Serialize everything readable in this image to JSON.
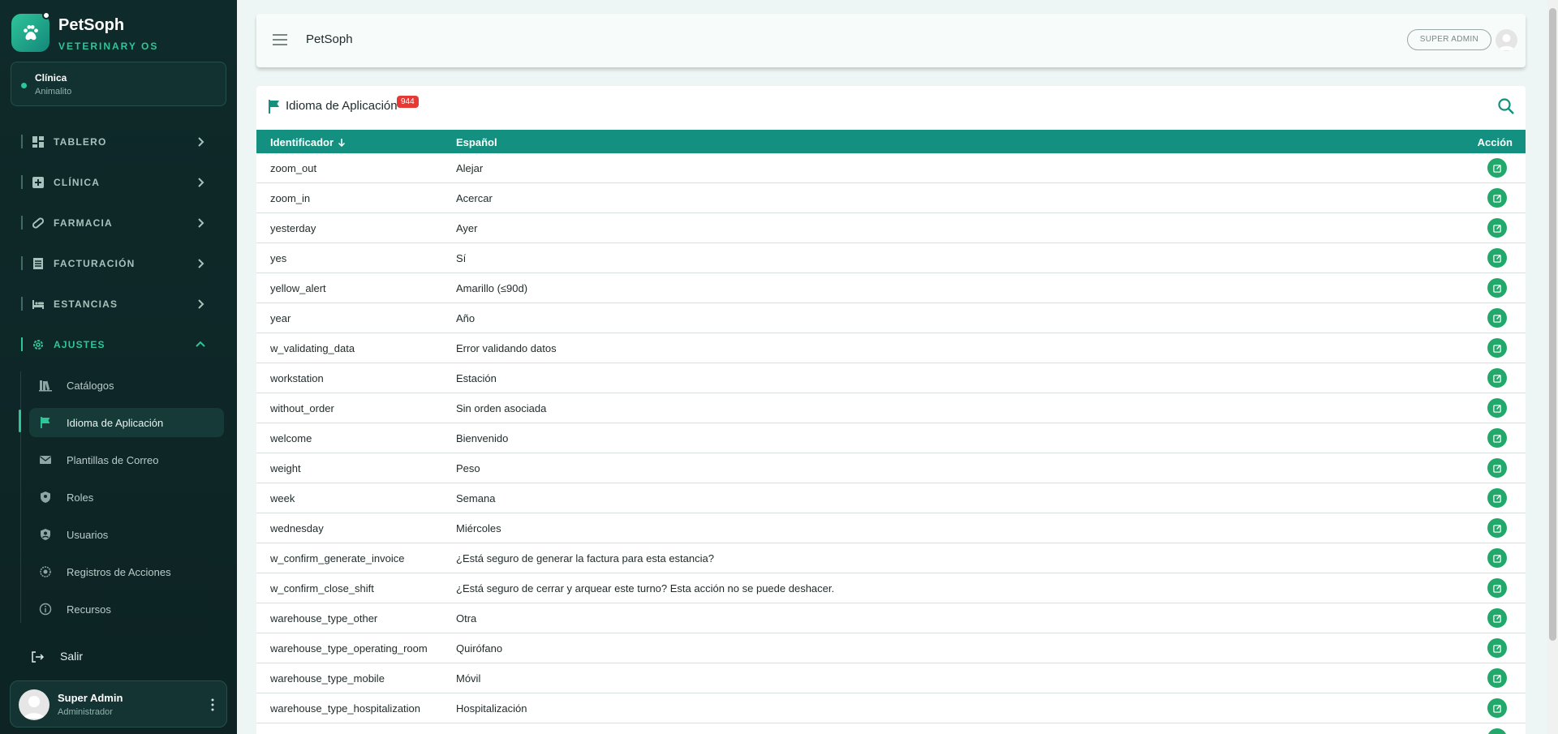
{
  "brand": {
    "name": "PetSoph",
    "subtitle": "VETERINARY OS"
  },
  "clinic": {
    "title": "Clínica",
    "name": "Animalito"
  },
  "nav": [
    {
      "label": "TABLERO",
      "icon": "dashboard-icon"
    },
    {
      "label": "CLÍNICA",
      "icon": "medical-plus-icon"
    },
    {
      "label": "FARMACIA",
      "icon": "pill-icon"
    },
    {
      "label": "FACTURACIÓN",
      "icon": "receipt-icon"
    },
    {
      "label": "ESTANCIAS",
      "icon": "bed-icon"
    },
    {
      "label": "AJUSTES",
      "icon": "gear-icon"
    }
  ],
  "subnav": [
    {
      "label": "Catálogos",
      "icon": "books-icon"
    },
    {
      "label": "Idioma de Aplicación",
      "icon": "flag-icon"
    },
    {
      "label": "Plantillas de Correo",
      "icon": "mail-template-icon"
    },
    {
      "label": "Roles",
      "icon": "shield-icon"
    },
    {
      "label": "Usuarios",
      "icon": "user-shield-icon"
    },
    {
      "label": "Registros de Acciones",
      "icon": "log-icon"
    },
    {
      "label": "Recursos",
      "icon": "info-icon"
    }
  ],
  "logout": {
    "label": "Salir"
  },
  "user": {
    "name": "Super Admin",
    "role": "Administrador"
  },
  "topbar": {
    "title": "PetSoph",
    "role_badge": "SUPER ADMIN"
  },
  "card": {
    "title": "Idioma de Aplicación",
    "count": "944"
  },
  "table": {
    "headers": {
      "id": "Identificador",
      "es": "Español",
      "action": "Acción"
    },
    "rows": [
      {
        "id": "zoom_out",
        "es": "Alejar"
      },
      {
        "id": "zoom_in",
        "es": "Acercar"
      },
      {
        "id": "yesterday",
        "es": "Ayer"
      },
      {
        "id": "yes",
        "es": "Sí"
      },
      {
        "id": "yellow_alert",
        "es": "Amarillo (≤90d)"
      },
      {
        "id": "year",
        "es": "Año"
      },
      {
        "id": "w_validating_data",
        "es": "Error validando datos"
      },
      {
        "id": "workstation",
        "es": "Estación"
      },
      {
        "id": "without_order",
        "es": "Sin orden asociada"
      },
      {
        "id": "welcome",
        "es": "Bienvenido"
      },
      {
        "id": "weight",
        "es": "Peso"
      },
      {
        "id": "week",
        "es": "Semana"
      },
      {
        "id": "wednesday",
        "es": "Miércoles"
      },
      {
        "id": "w_confirm_generate_invoice",
        "es": "¿Está seguro de generar la factura para esta estancia?"
      },
      {
        "id": "w_confirm_close_shift",
        "es": "¿Está seguro de cerrar y arquear este turno? Esta acción no se puede deshacer."
      },
      {
        "id": "warehouse_type_other",
        "es": "Otra"
      },
      {
        "id": "warehouse_type_operating_room",
        "es": "Quirófano"
      },
      {
        "id": "warehouse_type_mobile",
        "es": "Móvil"
      },
      {
        "id": "warehouse_type_hospitalization",
        "es": "Hospitalización"
      },
      {
        "id": "",
        "es": ""
      }
    ]
  },
  "colors": {
    "accent": "#13907f",
    "sidebar": "#0f2a2a",
    "edit": "#22a86b",
    "badge": "#e53935"
  }
}
